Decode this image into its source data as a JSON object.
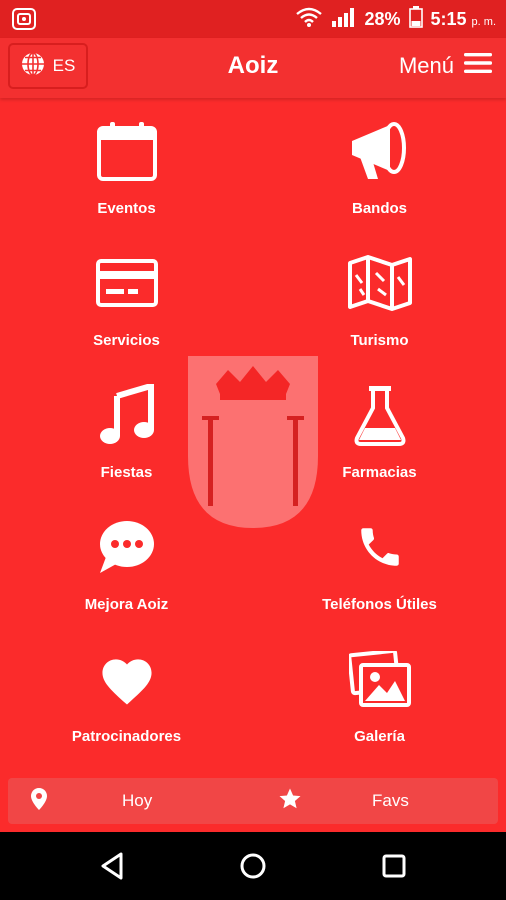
{
  "status": {
    "battery": "28%",
    "time": "5:15",
    "ampm": "p. m."
  },
  "appbar": {
    "language": "ES",
    "title": "Aoiz",
    "menu_label": "Menú"
  },
  "grid": {
    "items": [
      {
        "label": "Eventos",
        "icon": "calendar-icon"
      },
      {
        "label": "Bandos",
        "icon": "megaphone-icon"
      },
      {
        "label": "Servicios",
        "icon": "credit-card-icon"
      },
      {
        "label": "Turismo",
        "icon": "map-icon"
      },
      {
        "label": "Fiestas",
        "icon": "music-note-icon"
      },
      {
        "label": "Farmacias",
        "icon": "flask-icon"
      },
      {
        "label": "Mejora Aoiz",
        "icon": "chat-bubble-icon"
      },
      {
        "label": "Teléfonos Útiles",
        "icon": "phone-icon"
      },
      {
        "label": "Patrocinadores",
        "icon": "heart-icon"
      },
      {
        "label": "Galería",
        "icon": "gallery-icon"
      }
    ]
  },
  "bottombar": {
    "today_label": "Hoy",
    "favs_label": "Favs"
  },
  "colors": {
    "background": "#fb2b2b",
    "statusbar": "#e02121",
    "appbar": "#f33030",
    "bottombar": "#f14646"
  }
}
